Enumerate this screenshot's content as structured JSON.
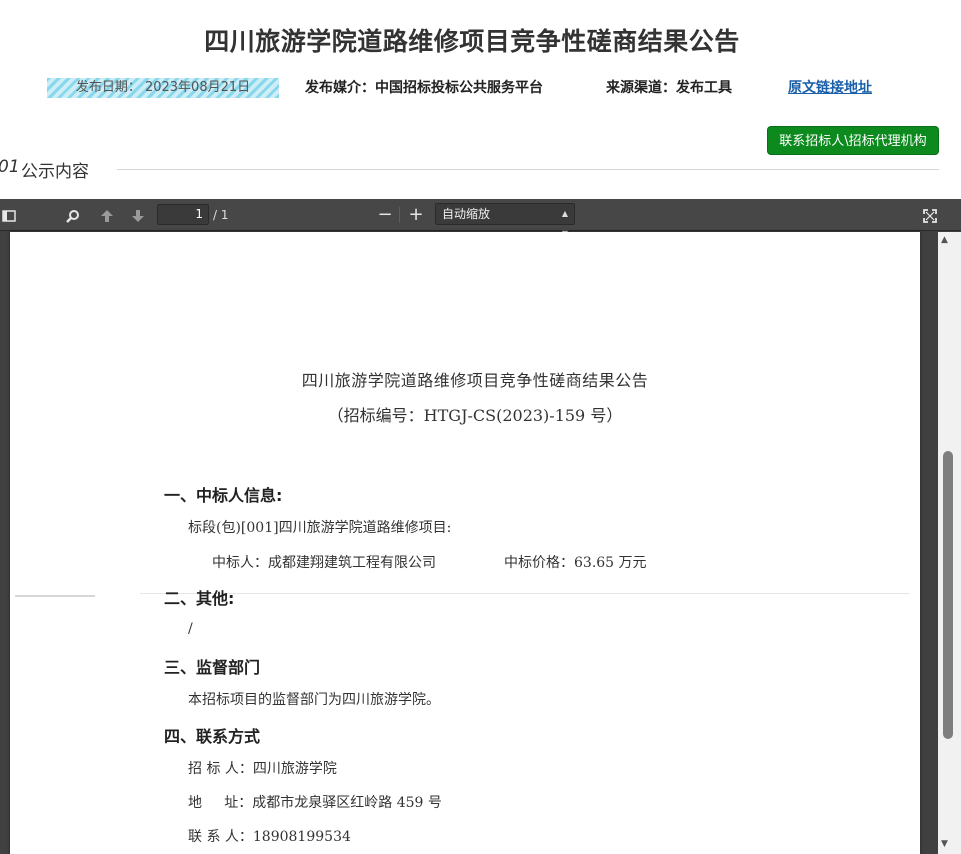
{
  "header": {
    "title": "四川旅游学院道路维修项目竞争性磋商结果公告",
    "publish_date": "发布日期：  2023年08月21日",
    "media": "发布媒介：中国招标投标公共服务平台",
    "source": "来源渠道：发布工具",
    "original_link": "原文链接地址"
  },
  "contact_button": "联系招标人\\招标代理机构",
  "section": {
    "number": "01",
    "label": "公示内容"
  },
  "viewer": {
    "page_current": "1",
    "page_total": "/ 1",
    "zoom": "自动缩放"
  },
  "document": {
    "title": "四川旅游学院道路维修项目竞争性磋商结果公告",
    "subtitle": "（招标编号：HTGJ-CS(2023)-159 号）",
    "s1_heading": "一、中标人信息:",
    "s1_lot": "标段(包)[001]四川旅游学院道路维修项目:",
    "s1_winner": "中标人：成都建翔建筑工程有限公司",
    "s1_price": "中标价格：63.65 万元",
    "s2_heading": "二、其他:",
    "s2_text": "/",
    "s3_heading": "三、监督部门",
    "s3_text": "本招标项目的监督部门为四川旅游学院。",
    "s4_heading": "四、联系方式",
    "contact_tenderer": "招 标 人：四川旅游学院",
    "contact_address": "地     址：成都市龙泉驿区红岭路 459 号",
    "contact_person": "联 系 人：18908199534"
  },
  "colors": {
    "button_green": "#0c8a1e",
    "link_blue": "#1a5fa8",
    "toolbar": "#474747"
  }
}
